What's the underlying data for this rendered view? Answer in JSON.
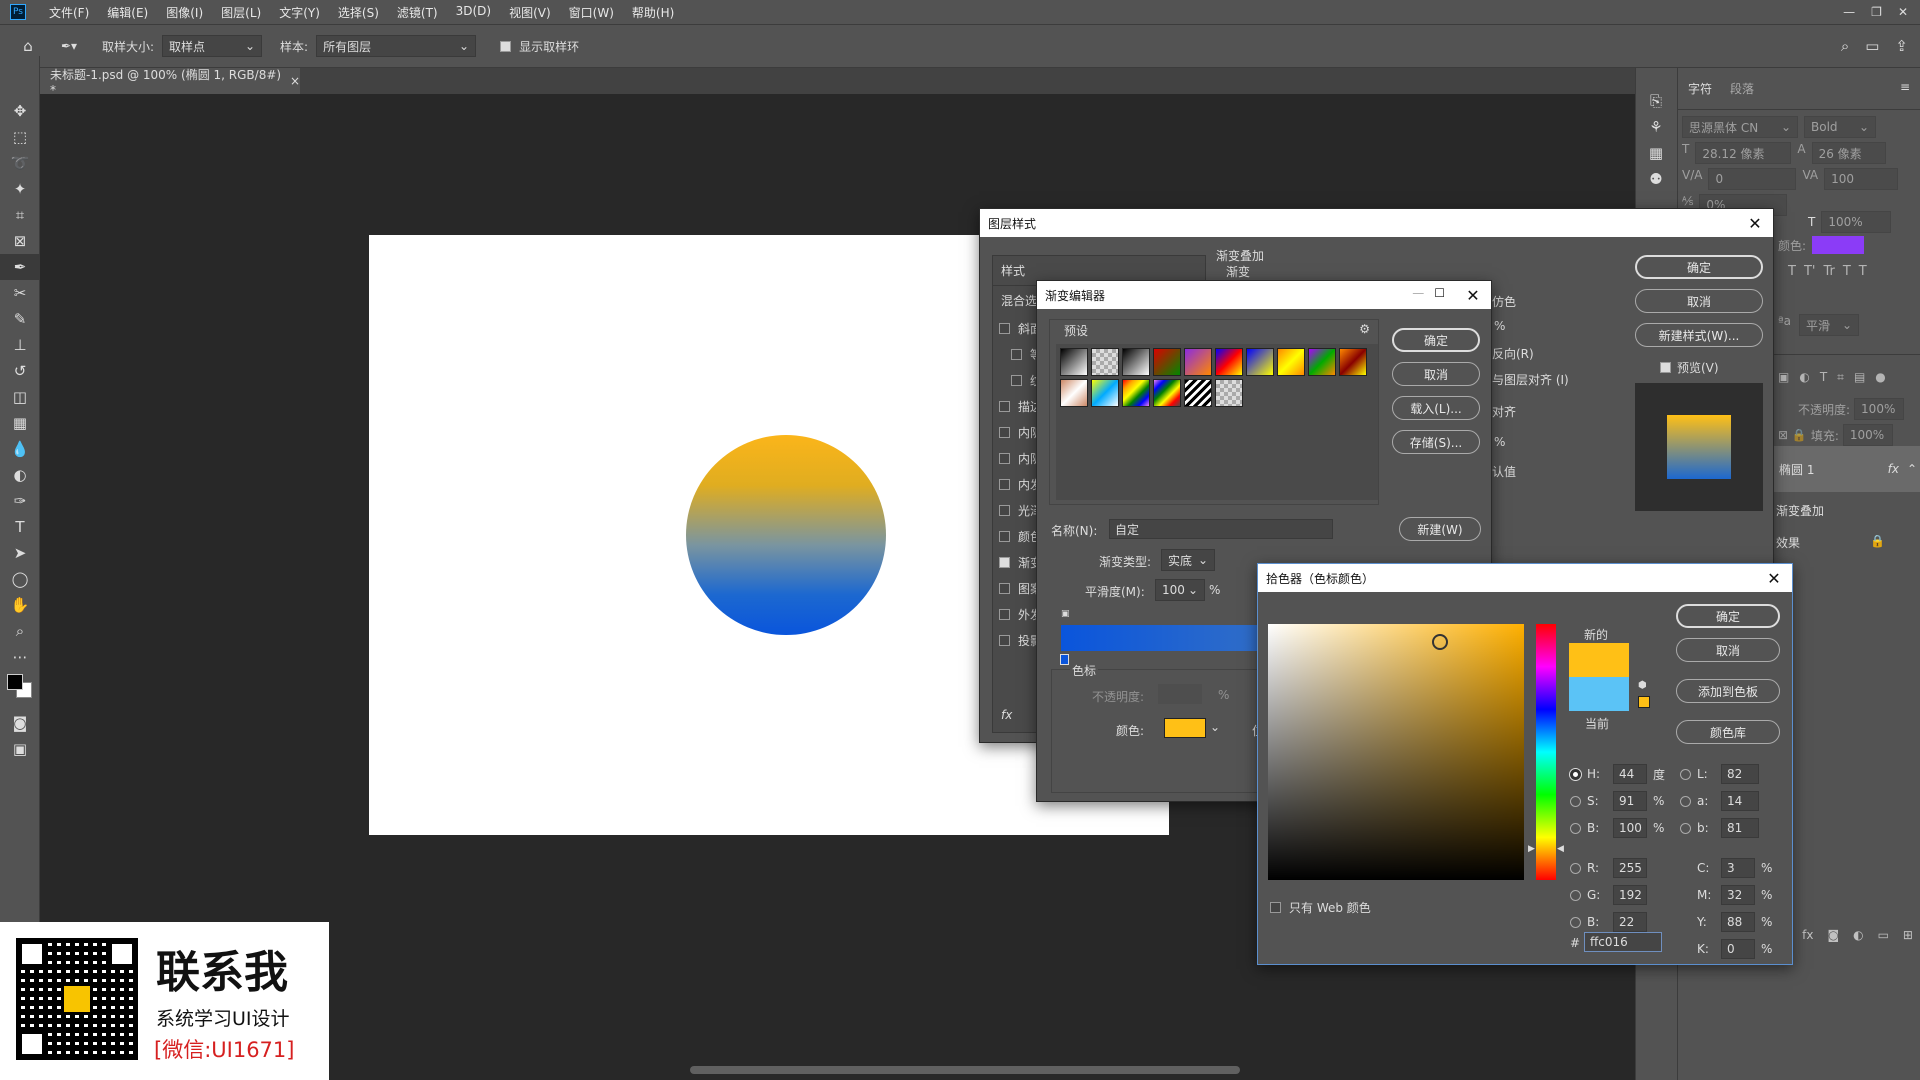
{
  "menu": [
    "文件(F)",
    "编辑(E)",
    "图像(I)",
    "图层(L)",
    "文字(Y)",
    "选择(S)",
    "滤镜(T)",
    "3D(D)",
    "视图(V)",
    "窗口(W)",
    "帮助(H)"
  ],
  "options": {
    "sample_size_label": "取样大小:",
    "sample_size_value": "取样点",
    "sample_label": "样本:",
    "sample_value": "所有图层",
    "show_ring_label": "显示取样环"
  },
  "doc_tab": {
    "title": "未标题-1.psd @ 100% (椭圆 1, RGB/8#) *",
    "close": "×"
  },
  "char_panel": {
    "tab_char": "字符",
    "tab_para": "段落",
    "font": "思源黑体 CN",
    "style": "Bold",
    "size": "28.12 像素",
    "leading": "26 像素",
    "tracking": "0",
    "kerning": "100",
    "scale": "0%",
    "v_scale": "100%",
    "color_label": "颜色:",
    "color": "#8b3cf7",
    "aa": "平滑"
  },
  "layers_panel": {
    "opacity_label": "不透明度:",
    "opacity": "100%",
    "fill_label": "填充:",
    "fill": "100%",
    "layer_name": "椭圆 1",
    "fx": "fx",
    "effect": "渐变叠加",
    "effects_label": "效果"
  },
  "layer_style": {
    "title": "图层样式",
    "left_header": "样式",
    "blend": "混合选项",
    "items": [
      {
        "label": "斜面和浮雕",
        "on": false,
        "indent": false
      },
      {
        "label": "等高线",
        "on": false,
        "indent": true
      },
      {
        "label": "纹理",
        "on": false,
        "indent": true
      },
      {
        "label": "描边",
        "on": false,
        "indent": false
      },
      {
        "label": "内阴影",
        "on": false,
        "indent": false
      },
      {
        "label": "内阴影",
        "on": false,
        "indent": false
      },
      {
        "label": "内发光",
        "on": false,
        "indent": false
      },
      {
        "label": "光泽",
        "on": false,
        "indent": false
      },
      {
        "label": "颜色叠加",
        "on": false,
        "indent": false
      },
      {
        "label": "渐变叠加",
        "on": true,
        "indent": false
      },
      {
        "label": "图案叠加",
        "on": false,
        "indent": false
      },
      {
        "label": "外发光",
        "on": false,
        "indent": false
      },
      {
        "label": "投影",
        "on": false,
        "indent": false
      }
    ],
    "section_title": "渐变叠加",
    "section_sub": "渐变",
    "frag_color": "仿色",
    "frag_reverse": "反向(R)",
    "frag_align": "与图层对齐 (I)",
    "frag_reset": "对齐",
    "frag_default": "认值",
    "pct": "%",
    "ok": "确定",
    "cancel": "取消",
    "new_style": "新建样式(W)...",
    "preview": "预览(V)",
    "fx": "fx"
  },
  "gradient_editor": {
    "title": "渐变编辑器",
    "presets": "预设",
    "ok": "确定",
    "cancel": "取消",
    "load": "载入(L)...",
    "save": "存储(S)...",
    "name_label": "名称(N):",
    "name_value": "自定",
    "new": "新建(W)",
    "type_label": "渐变类型:",
    "type_value": "实底",
    "smooth_label": "平滑度(M):",
    "smooth_value": "100",
    "pct": "%",
    "stops_label": "色标",
    "opacity_label": "不透明度:",
    "color_label": "颜色:",
    "pos_label": "位置"
  },
  "color_picker": {
    "title": "拾色器（色标颜色）",
    "new_label": "新的",
    "current_label": "当前",
    "new_color": "#ffc016",
    "current_color": "#5bc3f6",
    "ok": "确定",
    "cancel": "取消",
    "add_swatch": "添加到色板",
    "libraries": "颜色库",
    "web_only": "只有 Web 颜色",
    "H": "44",
    "S": "91",
    "B": "100",
    "R": "255",
    "G": "192",
    "Bb": "22",
    "L": "82",
    "a": "14",
    "b": "81",
    "C": "3",
    "M": "32",
    "Y": "88",
    "K": "0",
    "deg": "度",
    "pct": "%",
    "hash": "#",
    "hex": "ffc016",
    "lbl_H": "H:",
    "lbl_S": "S:",
    "lbl_B": "B:",
    "lbl_R": "R:",
    "lbl_G": "G:",
    "lbl_Bb": "B:",
    "lbl_L": "L:",
    "lbl_a": "a:",
    "lbl_b": "b:",
    "lbl_C": "C:",
    "lbl_M": "M:",
    "lbl_Y": "Y:",
    "lbl_K": "K:"
  },
  "promo": {
    "title": "联系我",
    "sub": "系统学习UI设计",
    "wechat": "[微信:UI1671]"
  }
}
